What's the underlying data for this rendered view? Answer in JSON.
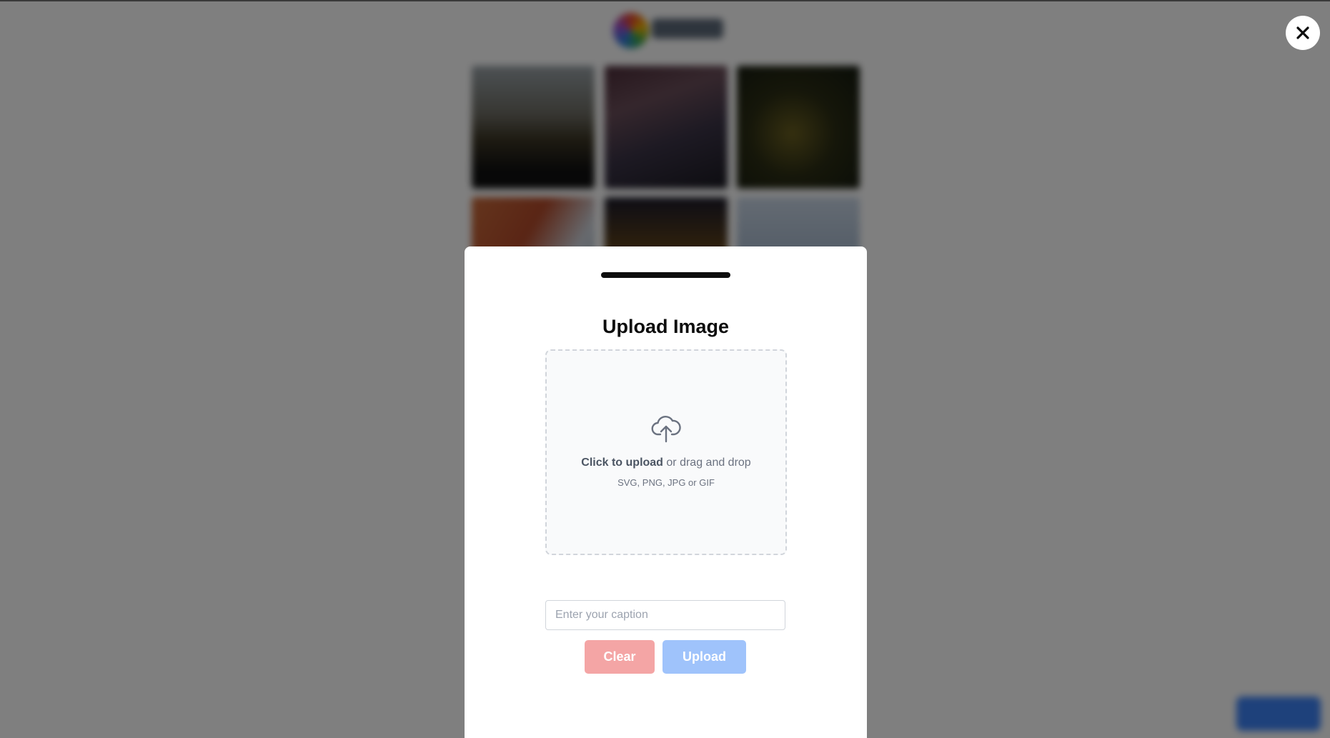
{
  "modal": {
    "title": "Upload Image",
    "dropzone": {
      "primary_action": "Click to upload",
      "secondary_text": " or drag and drop",
      "file_types": "SVG, PNG, JPG or GIF"
    },
    "caption": {
      "placeholder": "Enter your caption",
      "value": ""
    },
    "buttons": {
      "clear_label": "Clear",
      "upload_label": "Upload"
    }
  },
  "icons": {
    "close": "close-icon",
    "upload": "cloud-upload-icon"
  },
  "colors": {
    "overlay": "#000000",
    "clear_button": "#f4a5a5",
    "upload_button": "#9fc3fb",
    "title": "#0d0d0d",
    "muted_text": "#6b7280"
  }
}
